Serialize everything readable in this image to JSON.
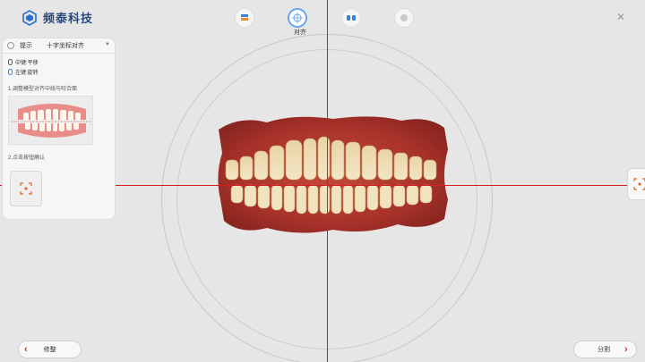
{
  "app": {
    "name": "频泰科技"
  },
  "toolbar": {
    "steps": [
      {
        "icon": "scan-stack-icon"
      },
      {
        "icon": "align-target-icon",
        "label": "对齐"
      },
      {
        "icon": "split-teeth-icon"
      },
      {
        "icon": "disabled-circle-icon"
      }
    ]
  },
  "panel": {
    "title": "提示",
    "mode": "十字坐标对齐",
    "hints": [
      {
        "label": "中键:平移"
      },
      {
        "label": "左键:旋转"
      }
    ],
    "step1": "1.调整模型对齐中线与咬合面",
    "step2": "2.点击按钮确认"
  },
  "footer": {
    "back_label": "修整",
    "next_label": "分割"
  },
  "colors": {
    "crosshair": "#d81e1e",
    "accent": "#3d7fd6",
    "arrow": "#c0312b"
  }
}
